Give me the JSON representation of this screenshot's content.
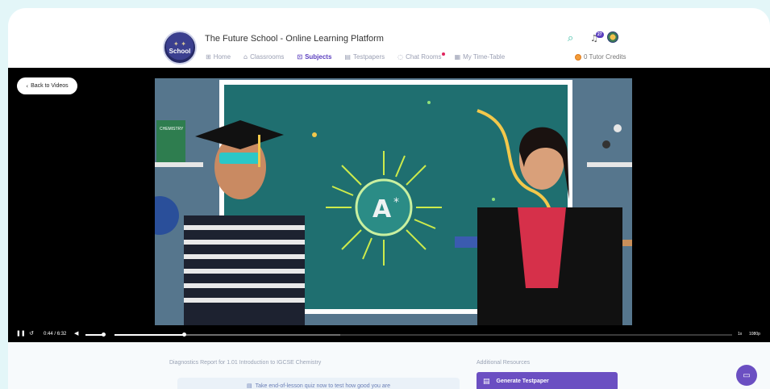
{
  "header": {
    "logo_text": "School",
    "logo_laurel": "✦ ✦",
    "title": "The Future School - Online Learning Platform",
    "notification_count": "27",
    "credits_label": "0 Tutor Credits"
  },
  "nav": [
    {
      "label": "Home",
      "icon": "⊞"
    },
    {
      "label": "Classrooms",
      "icon": "⌂"
    },
    {
      "label": "Subjects",
      "icon": "⊡",
      "active": true
    },
    {
      "label": "Testpapers",
      "icon": "▤"
    },
    {
      "label": "Chat Rooms",
      "icon": "◌"
    },
    {
      "label": "My Time-Table",
      "icon": "▦"
    }
  ],
  "player": {
    "back_label": "Back to Videos",
    "current_time": "0:44",
    "separator": "/",
    "duration": "6:32",
    "progress": 0.112,
    "volume": 0.9,
    "speed": "1x",
    "quality": "1080p",
    "book_label": "CHEMISTRY"
  },
  "diagnostics": {
    "title": "Diagnostics Report for 1.01 Introduction to IGCSE Chemistry",
    "quiz_label": "Take end-of-lesson quiz now to test how good you are"
  },
  "resources": {
    "title": "Additional Resources",
    "generate_label": "Generate Testpaper"
  },
  "colors": {
    "accent": "#6b4fc2",
    "page_bg": "#e3f6f8",
    "search_icon": "#3cbca4"
  }
}
